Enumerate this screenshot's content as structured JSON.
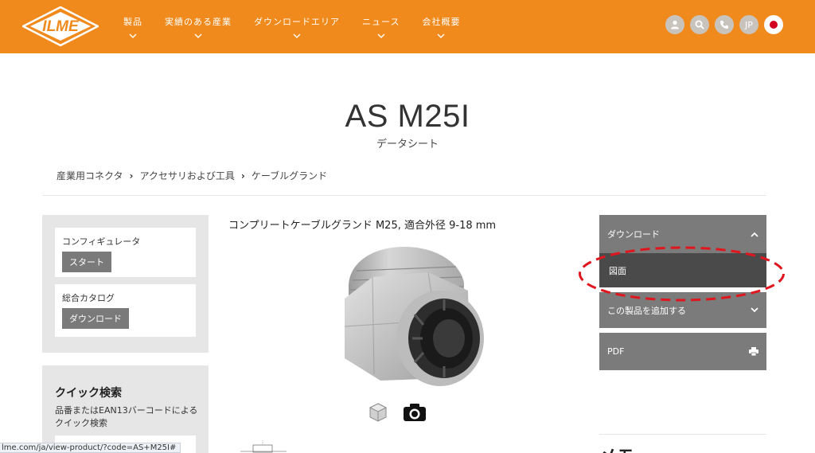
{
  "header": {
    "logo_text": "ILME",
    "nav": [
      {
        "label": "製品"
      },
      {
        "label": "実績のある産業"
      },
      {
        "label": "ダウンロードエリア"
      },
      {
        "label": "ニュース"
      },
      {
        "label": "会社概要"
      }
    ],
    "icons": [
      "user-icon",
      "search-icon",
      "phone-icon"
    ],
    "language": "JP"
  },
  "page": {
    "title": "AS M25I",
    "subtitle": "データシート"
  },
  "breadcrumb": [
    "産業用コネクタ",
    "アクセサリおよび工具",
    "ケーブルグランド"
  ],
  "sidebar": {
    "configurator_label": "コンフィギュレータ",
    "configurator_button": "スタート",
    "catalog_label": "総合カタログ",
    "catalog_button": "ダウンロード",
    "quick_title": "クイック検索",
    "quick_desc": "品番またはEAN13バーコードによるクイック検索"
  },
  "product": {
    "title": "コンプリートケーブルグランド M25, 適合外径 9-18 mm"
  },
  "right_panel": {
    "download": "ダウンロード",
    "drawing": "図面",
    "add_product": "この製品を追加する",
    "pdf": "PDF",
    "bottom_title": "メモ"
  },
  "status_bar": {
    "url": "lme.com/ja/view-product/?code=AS+M25I#"
  },
  "colors": {
    "header_bg": "#f08a1c",
    "panel_grey": "#7b7b7b",
    "selected_dark": "#4a4a4a",
    "annotation_red": "#e0161e"
  }
}
